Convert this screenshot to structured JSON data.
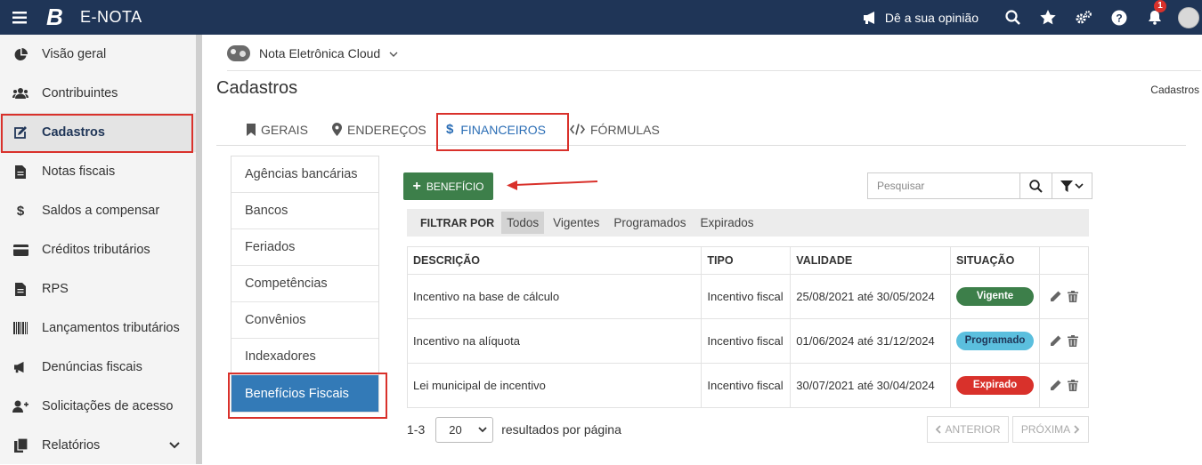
{
  "topbar": {
    "logo": "B",
    "app_name": "E-NOTA",
    "opinion_label": "Dê a sua opinião",
    "notification_count": "1",
    "icons": [
      "menu-icon",
      "megaphone-icon",
      "search-icon",
      "star-icon",
      "gears-icon",
      "help-icon",
      "bell-icon",
      "avatar"
    ]
  },
  "sidebar": {
    "items": [
      {
        "label": "Visão geral",
        "icon": "pie-chart-icon"
      },
      {
        "label": "Contribuintes",
        "icon": "users-icon"
      },
      {
        "label": "Cadastros",
        "icon": "edit-icon",
        "active": true
      },
      {
        "label": "Notas fiscais",
        "icon": "file-icon"
      },
      {
        "label": "Saldos a compensar",
        "icon": "dollar-icon"
      },
      {
        "label": "Créditos tributários",
        "icon": "credit-card-icon"
      },
      {
        "label": "RPS",
        "icon": "file-icon"
      },
      {
        "label": "Lançamentos tributários",
        "icon": "barcode-icon"
      },
      {
        "label": "Denúncias fiscais",
        "icon": "megaphone-icon"
      },
      {
        "label": "Solicitações de acesso",
        "icon": "user-plus-icon"
      },
      {
        "label": "Relatórios",
        "icon": "copy-icon"
      }
    ]
  },
  "company": {
    "name": "Nota Eletrônica Cloud"
  },
  "page": {
    "title": "Cadastros",
    "breadcrumb": "Cadastros"
  },
  "tabs": [
    {
      "label": "GERAIS",
      "icon": "bookmark-icon"
    },
    {
      "label": "ENDEREÇOS",
      "icon": "map-marker-icon"
    },
    {
      "label": "FINANCEIROS",
      "icon": "dollar-icon",
      "active": true
    },
    {
      "label": "FÓRMULAS",
      "icon": "code-icon"
    }
  ],
  "left_menu": [
    "Agências bancárias",
    "Bancos",
    "Feriados",
    "Competências",
    "Convênios",
    "Indexadores",
    "Benefícios Fiscais"
  ],
  "toolbar": {
    "add_label": "BENEFÍCIO",
    "search_placeholder": "Pesquisar"
  },
  "filter": {
    "label": "FILTRAR POR",
    "options": [
      "Todos",
      "Vigentes",
      "Programados",
      "Expirados"
    ],
    "selected": "Todos"
  },
  "table": {
    "headers": [
      "DESCRIÇÃO",
      "TIPO",
      "VALIDADE",
      "SITUAÇÃO",
      ""
    ],
    "rows": [
      {
        "descricao": "Incentivo na base de cálculo",
        "tipo": "Incentivo fiscal",
        "validade": "25/08/2021 até 30/05/2024",
        "situacao": "Vigente",
        "color": "#3d7f4a"
      },
      {
        "descricao": "Incentivo na alíquota",
        "tipo": "Incentivo fiscal",
        "validade": "01/06/2024 até 31/12/2024",
        "situacao": "Programado",
        "color": "#5bbfde"
      },
      {
        "descricao": "Lei municipal de incentivo",
        "tipo": "Incentivo fiscal",
        "validade": "30/07/2021 até 30/04/2024",
        "situacao": "Expirado",
        "color": "#d9312b"
      }
    ]
  },
  "pagination": {
    "range": "1-3",
    "page_size": "20",
    "per_page_label": "resultados por página",
    "prev_label": "ANTERIOR",
    "next_label": "PRÓXIMA"
  },
  "colors": {
    "topbar": "#1f3557",
    "accent": "#337ab7",
    "highlight": "#d9312b"
  }
}
